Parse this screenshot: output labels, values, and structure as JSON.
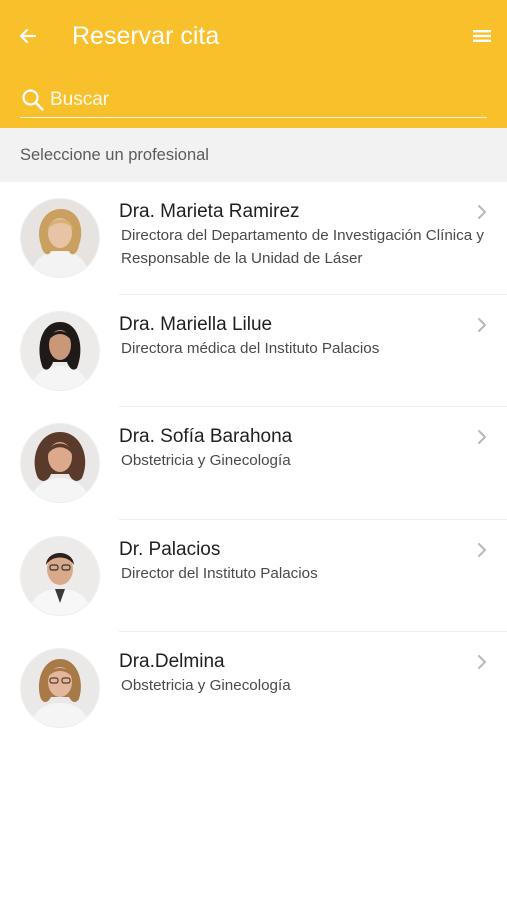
{
  "header": {
    "title": "Reservar cita",
    "back_icon": "arrow-left-icon",
    "menu_icon": "hamburger-menu-icon",
    "background_color": "#F8C02A"
  },
  "search": {
    "placeholder": "Buscar",
    "value": "",
    "icon": "search-icon"
  },
  "section": {
    "label": "Seleccione un profesional"
  },
  "professionals": [
    {
      "name": "Dra. Marieta Ramirez",
      "role": "Directora del Departamento de Investigación Clínica y Responsable de la Unidad de Láser"
    },
    {
      "name": "Dra. Mariella Lilue",
      "role": "Directora médica del Instituto Palacios"
    },
    {
      "name": "Dra. Sofía Barahona",
      "role": "Obstetricia y Ginecología"
    },
    {
      "name": "Dr. Palacios",
      "role": "Director del Instituto Palacios"
    },
    {
      "name": "Dra.Delmina",
      "role": "Obstetricia y Ginecología"
    }
  ]
}
